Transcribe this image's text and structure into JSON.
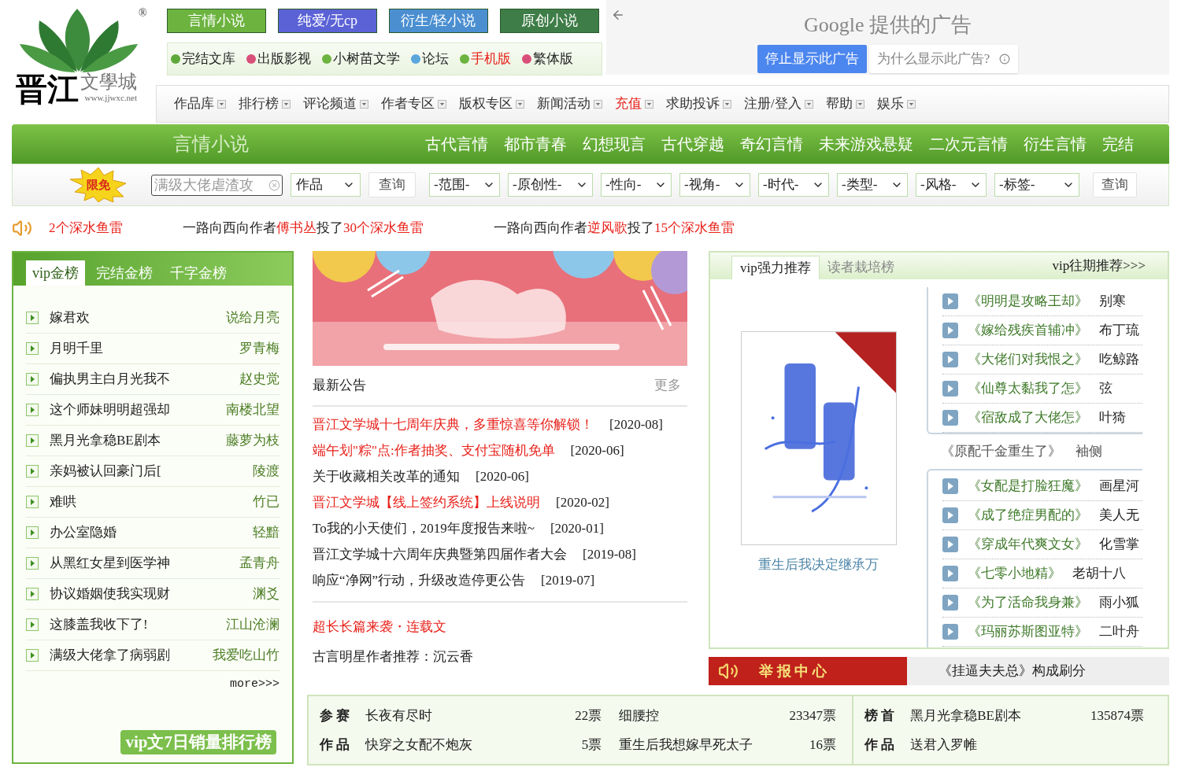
{
  "logo": {
    "mark": "晋江",
    "name": "文學城",
    "url": "www.jjwxc.net",
    "registered": "®"
  },
  "channels": [
    {
      "label": "言情小说",
      "color": "#6cb33f"
    },
    {
      "label": "纯爱/无cp",
      "color": "#5b62d6"
    },
    {
      "label": "衍生/轻小说",
      "color": "#4b8fd1"
    },
    {
      "label": "原创小说",
      "color": "#3e7d47"
    }
  ],
  "links": [
    {
      "label": "完结文库",
      "color": "#5fa83a",
      "highlight": false
    },
    {
      "label": "出版影视",
      "color": "#d94f7a",
      "highlight": false
    },
    {
      "label": "小树苗文学",
      "color": "#6cb33f",
      "highlight": false
    },
    {
      "label": "论坛",
      "color": "#5aa6dd",
      "highlight": false
    },
    {
      "label": "手机版",
      "color": "#6cb33f",
      "highlight": true
    },
    {
      "label": "繁体版",
      "color": "#d94f7a",
      "highlight": false
    }
  ],
  "ad": {
    "title": "Google 提供的广告",
    "stop_button": "停止显示此广告",
    "why_button": "为什么显示此广告?"
  },
  "nav": [
    {
      "label": "作品库",
      "highlight": false
    },
    {
      "label": "排行榜",
      "highlight": false
    },
    {
      "label": "评论频道",
      "highlight": false
    },
    {
      "label": "作者专区",
      "highlight": false
    },
    {
      "label": "版权专区",
      "highlight": false
    },
    {
      "label": "新闻活动",
      "highlight": false
    },
    {
      "label": "充值",
      "highlight": true
    },
    {
      "label": "求助投诉",
      "highlight": false
    },
    {
      "label": "注册/登入",
      "highlight": false
    },
    {
      "label": "帮助",
      "highlight": false
    },
    {
      "label": "娱乐",
      "highlight": false
    }
  ],
  "category_bar": {
    "title": "言情小说",
    "items": [
      "古代言情",
      "都市青春",
      "幻想现言",
      "古代穿越",
      "奇幻言情",
      "未来游戏悬疑",
      "二次元言情",
      "衍生言情",
      "完结"
    ]
  },
  "search": {
    "badge": "限免",
    "value": "满级大佬虐渣攻",
    "type": "作品",
    "button": "查询",
    "filters": [
      "-范围-",
      "-原创性-",
      "-性向-",
      "-视角-",
      "-时代-",
      "-类型-",
      "-风格-",
      "-标签-"
    ],
    "filter_button": "查询"
  },
  "ticker": [
    {
      "parts": [
        {
          "text": "2个深水鱼雷",
          "kind": "name"
        }
      ]
    },
    {
      "parts": [
        {
          "text": "一路向西向作者",
          "kind": "plain"
        },
        {
          "text": "傅书丛",
          "kind": "name"
        },
        {
          "text": "投了",
          "kind": "plain"
        },
        {
          "text": "30个深水鱼雷",
          "kind": "name"
        }
      ]
    },
    {
      "parts": [
        {
          "text": "一路向西向作者",
          "kind": "plain"
        },
        {
          "text": "逆风歌",
          "kind": "name"
        },
        {
          "text": "投了",
          "kind": "plain"
        },
        {
          "text": "15个深水鱼雷",
          "kind": "name"
        }
      ]
    }
  ],
  "rank_panel": {
    "tabs": [
      {
        "label": "vip金榜",
        "selected": true
      },
      {
        "label": "完结金榜",
        "selected": false
      },
      {
        "label": "千字金榜",
        "selected": false
      }
    ],
    "rows": [
      {
        "title": "嫁君欢",
        "author": "说给月亮"
      },
      {
        "title": "月明千里",
        "author": "罗青梅"
      },
      {
        "title": "偏执男主白月光我不",
        "author": "赵史觉"
      },
      {
        "title": "这个师妹明明超强却",
        "author": "南楼北望"
      },
      {
        "title": "黑月光拿稳BE剧本",
        "author": "藤萝为枝"
      },
      {
        "title": "亲妈被认回豪门后[",
        "author": "陵渡"
      },
      {
        "title": "难哄",
        "author": "竹已"
      },
      {
        "title": "办公室隐婚",
        "author": "轻黯"
      },
      {
        "title": "从黑红女星到医学神",
        "author": "孟青舟"
      },
      {
        "title": "协议婚姻使我实现财",
        "author": "渊爻"
      },
      {
        "title": "这膝盖我收下了!",
        "author": "江山沧澜"
      },
      {
        "title": "满级大佬拿了病弱剧",
        "author": "我爱吃山竹"
      }
    ],
    "more": "more>>>",
    "caption": "vip文7日销量排行榜"
  },
  "notices": {
    "title": "最新公告",
    "more": "更多",
    "items": [
      {
        "text": "晋江文学城十七周年庆典，多重惊喜等你解锁！",
        "date": "[2020-08]",
        "highlight": true
      },
      {
        "text": "端午划\"粽\"点:作者抽奖、支付宝随机免单",
        "date": "[2020-06]",
        "highlight": true
      },
      {
        "text": "关于收藏相关改革的通知",
        "date": "[2020-06]",
        "highlight": false
      },
      {
        "text": "晋江文学城【线上签约系统】上线说明",
        "date": "[2020-02]",
        "highlight": true
      },
      {
        "text": "To我的小天使们，2019年度报告来啦~",
        "date": "[2020-01]",
        "highlight": false
      },
      {
        "text": "晋江文学城十六周年庆典暨第四届作者大会",
        "date": "[2019-08]",
        "highlight": false
      },
      {
        "text": "响应“净网”行动，升级改造停更公告",
        "date": "[2019-07]",
        "highlight": false
      }
    ]
  },
  "serial": {
    "title": "超长长篇来袭・连载文",
    "line": "古言明星作者推荐：沉云香"
  },
  "recommend": {
    "tabs": [
      {
        "label": "vip强力推荐",
        "selected": true
      },
      {
        "label": "读者栽培榜",
        "selected": false
      }
    ],
    "more": "vip往期推荐>>>",
    "cover_caption": "重生后我决定继承万",
    "list_top": [
      {
        "title": "《明明是攻略王却》",
        "author": "别寒"
      },
      {
        "title": "《嫁给残疾首辅冲》",
        "author": "布丁琉"
      },
      {
        "title": "《大佬们对我恨之》",
        "author": "吃鲸路"
      },
      {
        "title": "《仙尊太黏我了怎》",
        "author": "弦"
      },
      {
        "title": "《宿敌成了大佬怎》",
        "author": "叶猗"
      }
    ],
    "featured": {
      "title": "《原配千金重生了》",
      "author": "袖侧"
    },
    "list_bottom": [
      {
        "title": "《女配是打脸狂魔》",
        "author": "画星河"
      },
      {
        "title": "《成了绝症男配的》",
        "author": "美人无"
      },
      {
        "title": "《穿成年代爽文女》",
        "author": "化雪掌"
      },
      {
        "title": "《七零小地精》",
        "author": "老胡十八"
      },
      {
        "title": "《为了活命我身兼》",
        "author": "雨小狐"
      },
      {
        "title": "《玛丽苏斯图亚特》",
        "author": "二叶舟"
      }
    ]
  },
  "report": {
    "label": "举 报 中 心",
    "message": "《挂逼夫夫总》构成刷分"
  },
  "contest": {
    "labels": [
      "参 赛",
      "作 品"
    ],
    "rows": [
      [
        {
          "title": "长夜有尽时",
          "votes": "22票"
        },
        {
          "title": "细腰控",
          "votes": "23347票"
        }
      ],
      [
        {
          "title": "快穿之女配不炮灰",
          "votes": "5票"
        },
        {
          "title": "重生后我想嫁早死太子",
          "votes": "16票"
        }
      ]
    ]
  },
  "top": {
    "labels": [
      "榜 首",
      "作 品"
    ],
    "rows": [
      {
        "title": "黑月光拿稳BE剧本",
        "votes": "135874票"
      },
      {
        "title": "送君入罗帷"
      }
    ]
  }
}
